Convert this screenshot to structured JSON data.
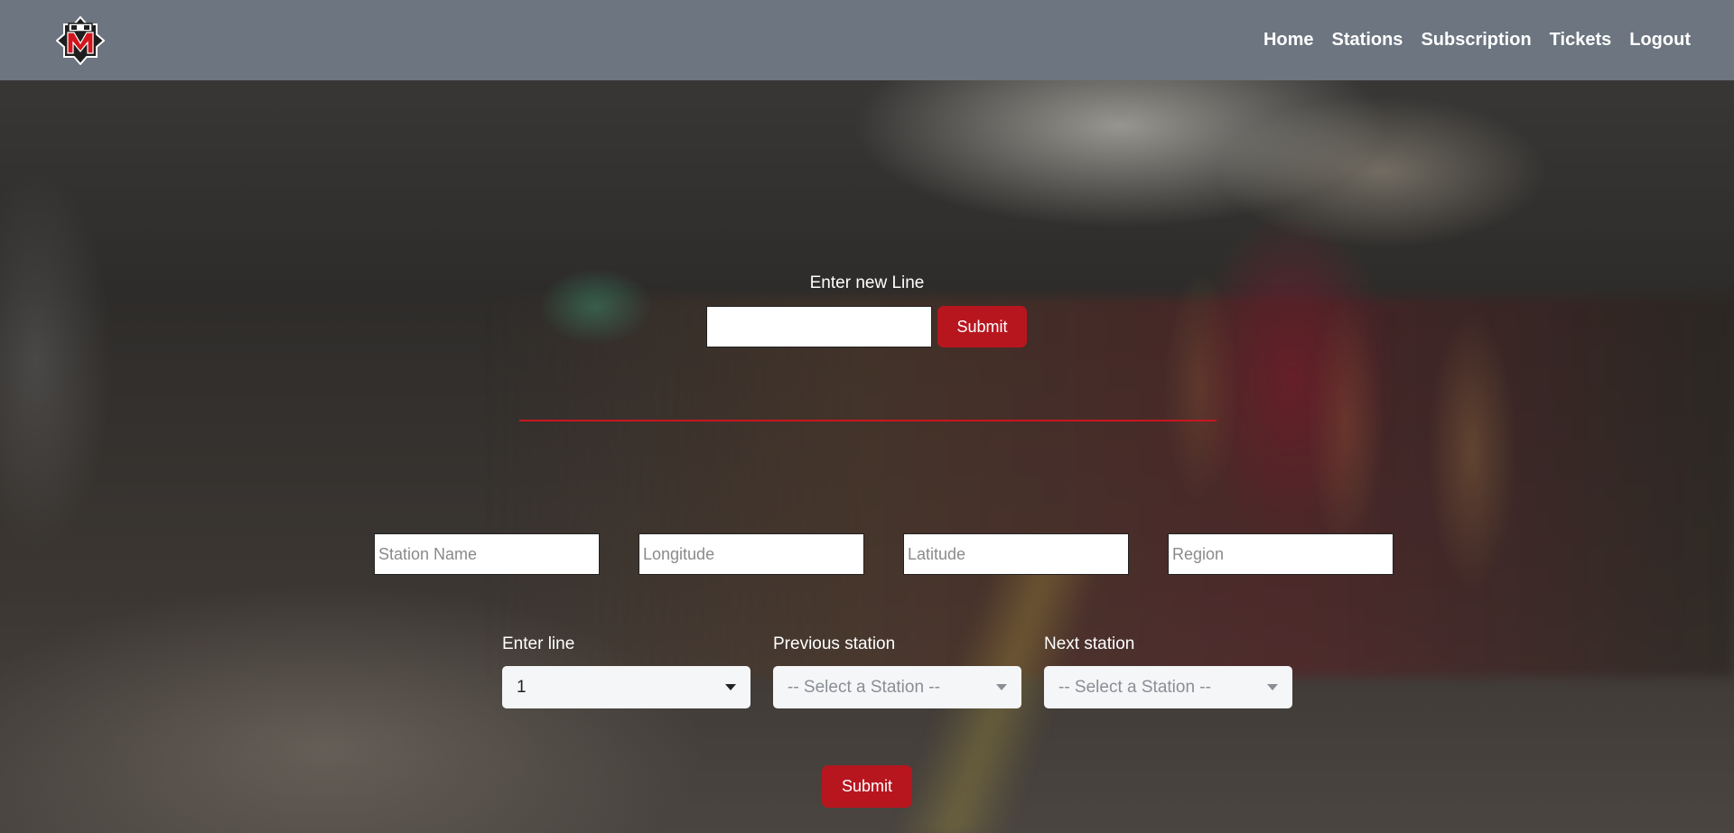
{
  "nav": {
    "links": [
      "Home",
      "Stations",
      "Subscription",
      "Tickets",
      "Logout"
    ]
  },
  "new_line": {
    "label": "Enter new Line",
    "input_value": "",
    "submit_label": "Submit"
  },
  "station_form": {
    "station_name_placeholder": "Station Name",
    "longitude_placeholder": "Longitude",
    "latitude_placeholder": "Latitude",
    "region_placeholder": "Region",
    "line_label": "Enter line",
    "line_value": "1",
    "previous_label": "Previous station",
    "previous_value": "-- Select a Station --",
    "next_label": "Next station",
    "next_value": "-- Select a Station --",
    "submit_label": "Submit"
  },
  "colors": {
    "navbar": "#6c7580",
    "accent": "#b8161f",
    "divider": "#c8161e"
  },
  "icons": {
    "logo": "metro-logo-icon",
    "dropdown": "caret-down-icon"
  }
}
